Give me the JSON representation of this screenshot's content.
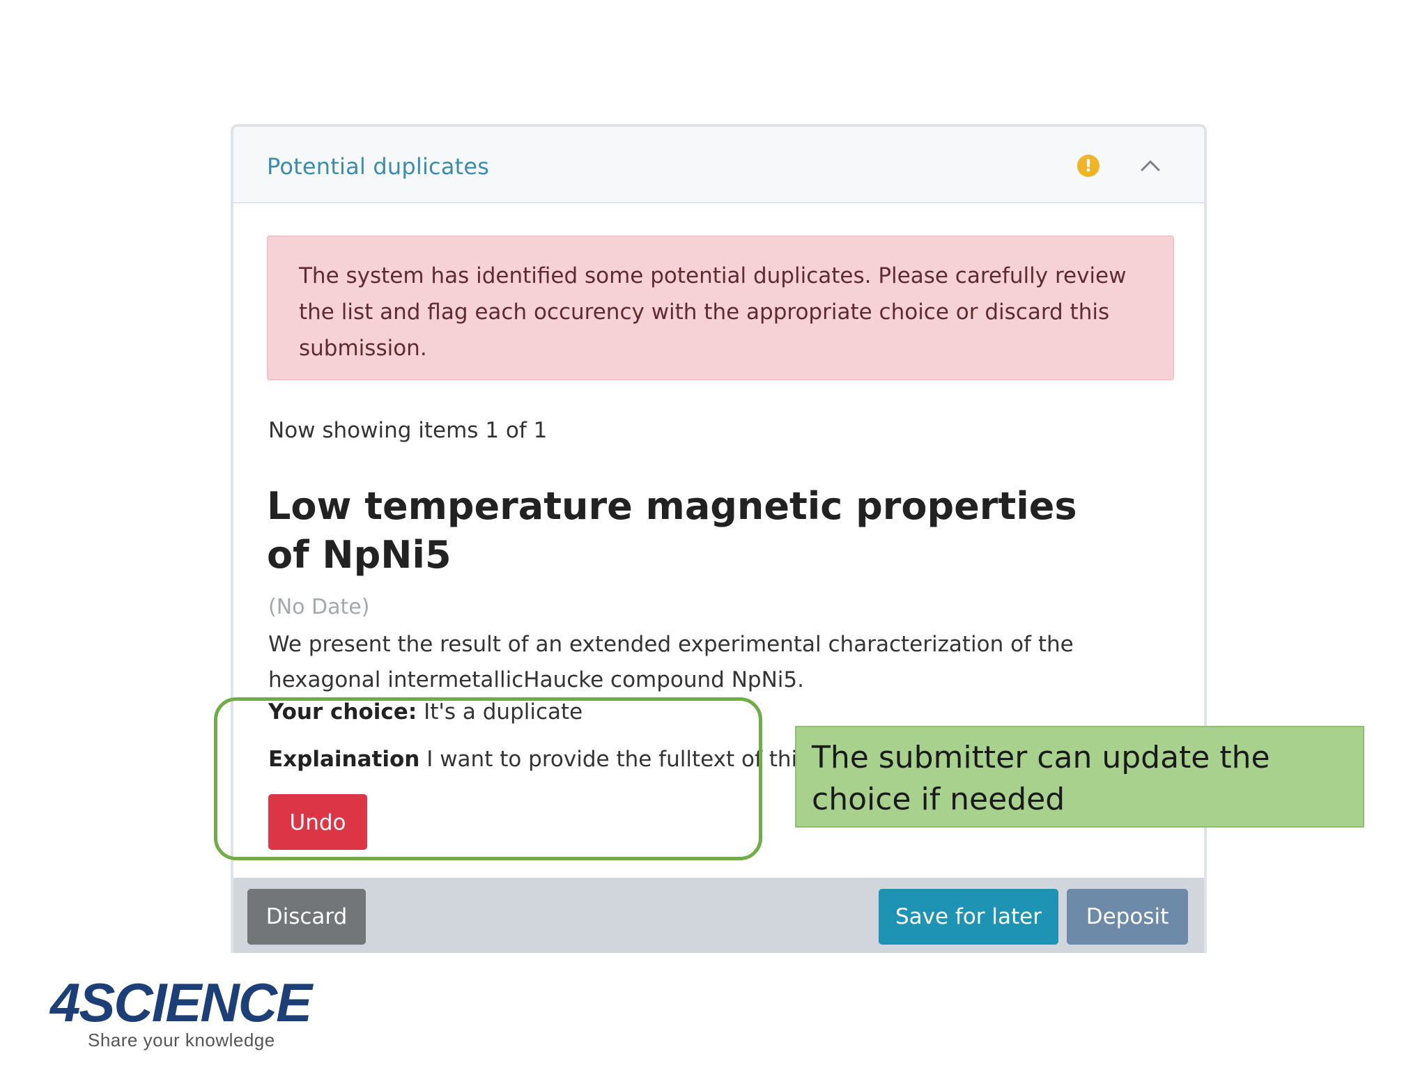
{
  "panel": {
    "title": "Potential duplicates",
    "icons": {
      "status": "exclamation-circle-icon",
      "toggle": "chevron-up-icon"
    },
    "alert_text": "The system has identified some potential duplicates. Please carefully review the list and flag each occurency with the appropriate choice or discard this submission.",
    "showing_text": "Now showing items 1 of 1"
  },
  "item": {
    "title": "Low temperature magnetic properties of NpNi5",
    "date": "(No Date)",
    "abstract": "We present the result of an extended experimental characterization of the hexagonal intermetallicHaucke compound NpNi5.",
    "choice_label": "Your choice:",
    "choice_value": "It's a duplicate",
    "explanation_label": "Explaination",
    "explanation_value": "I want to provide the fulltext of this",
    "undo_label": "Undo"
  },
  "footer": {
    "discard_label": "Discard",
    "save_label": "Save for later",
    "deposit_label": "Deposit"
  },
  "annotation": {
    "callout_text": "The submitter can update the choice if needed"
  },
  "logo": {
    "wordmark": "4SCIENCE",
    "tagline": "Share your knowledge"
  },
  "colors": {
    "accent_title": "#3d8bab",
    "alert_bg": "#f6d2d6",
    "undo": "#dc3545",
    "discard": "#727679",
    "save": "#1f93b3",
    "deposit": "#6d8aa9",
    "annotation_green": "#70ad47",
    "callout_bg": "#a9d18e",
    "warning": "#f0b429",
    "logo_blue": "#1d3f78"
  }
}
